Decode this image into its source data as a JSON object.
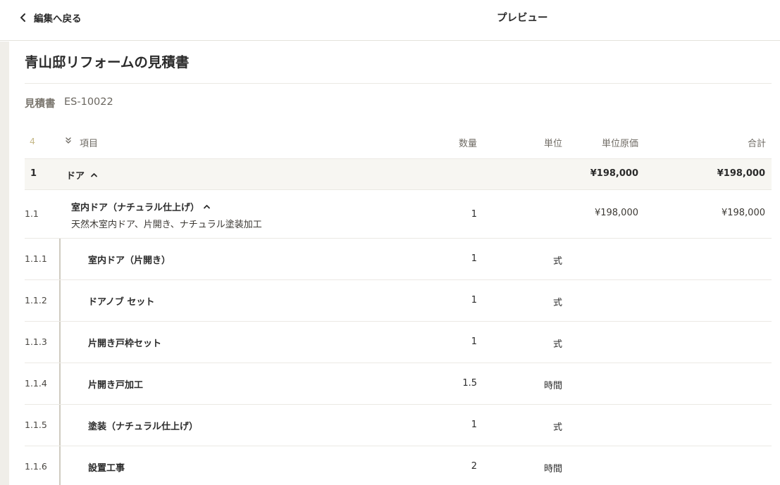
{
  "header": {
    "back_label": "編集へ戻る",
    "title": "プレビュー"
  },
  "document": {
    "title": "青山邸リフォームの見積書",
    "estimate_label": "見積書",
    "estimate_number": "ES-10022"
  },
  "table": {
    "count": "4",
    "columns": {
      "item": "項目",
      "quantity": "数量",
      "unit": "単位",
      "unit_cost": "単位原価",
      "total": "合計"
    },
    "group": {
      "no": "1",
      "name": "ドア",
      "unit_cost": "¥198,000",
      "total": "¥198,000"
    },
    "item": {
      "no": "1.1",
      "name": "室内ドア（ナチュラル仕上げ）",
      "description": "天然木室内ドア、片開き、ナチュラル塗装加工",
      "quantity": "1",
      "unit_cost": "¥198,000",
      "total": "¥198,000"
    },
    "subitems": [
      {
        "no": "1.1.1",
        "name": "室内ドア（片開き）",
        "quantity": "1",
        "unit": "式"
      },
      {
        "no": "1.1.2",
        "name": "ドアノブ セット",
        "quantity": "1",
        "unit": "式"
      },
      {
        "no": "1.1.3",
        "name": "片開き戸枠セット",
        "quantity": "1",
        "unit": "式"
      },
      {
        "no": "1.1.4",
        "name": "片開き戸加工",
        "quantity": "1.5",
        "unit": "時間"
      },
      {
        "no": "1.1.5",
        "name": "塗装（ナチュラル仕上げ）",
        "quantity": "1",
        "unit": "式"
      },
      {
        "no": "1.1.6",
        "name": "設置工事",
        "quantity": "2",
        "unit": "時間"
      }
    ]
  },
  "icons": {
    "back": "chevron-left-icon",
    "collapse_all": "double-chevron-down-icon",
    "group_toggle": "chevron-up-icon",
    "item_toggle": "chevron-up-icon"
  },
  "colors": {
    "accent_count": "#c6b98a",
    "group_row_bg": "#f7f6f2",
    "rail_bg": "#f0eee9"
  }
}
